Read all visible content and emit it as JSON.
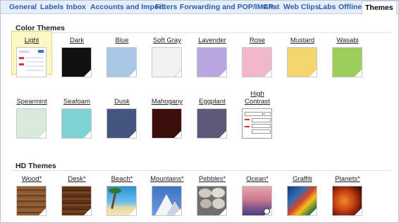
{
  "tabs": [
    {
      "label": "General",
      "active": false
    },
    {
      "label": "Labels",
      "active": false
    },
    {
      "label": "Inbox",
      "active": false
    },
    {
      "label": "Accounts and Import",
      "active": false
    },
    {
      "label": "Filters",
      "active": false
    },
    {
      "label": "Forwarding and POP/IMAP",
      "active": false
    },
    {
      "label": "Chat",
      "active": false
    },
    {
      "label": "Web Clips",
      "active": false
    },
    {
      "label": "Labs",
      "active": false
    },
    {
      "label": "Offline",
      "active": false
    },
    {
      "label": "Themes",
      "active": true
    }
  ],
  "color_themes": {
    "title": "Color Themes",
    "items": [
      {
        "label": "Light",
        "color": "#ffffff",
        "selected": true
      },
      {
        "label": "Dark",
        "color": "#111111"
      },
      {
        "label": "Blue",
        "color": "#a8c8e6"
      },
      {
        "label": "Soft Gray",
        "color": "#f0f0f0"
      },
      {
        "label": "Lavender",
        "color": "#b8a6df"
      },
      {
        "label": "Rose",
        "color": "#f0b8c8"
      },
      {
        "label": "Mustard",
        "color": "#f0d66c"
      },
      {
        "label": "Wasabi",
        "color": "#9ccc5a"
      },
      {
        "label": "Spearmint",
        "color": "#d7eadc"
      },
      {
        "label": "Seafoam",
        "color": "#7fd2d4"
      },
      {
        "label": "Dusk",
        "color": "#44557f"
      },
      {
        "label": "Mahogany",
        "color": "#3a0e0a"
      },
      {
        "label": "Eggplant",
        "color": "#5e5878"
      },
      {
        "label": "High Contrast",
        "color": "#ffffff"
      }
    ]
  },
  "hd_themes": {
    "title": "HD Themes",
    "items": [
      {
        "label": "Wood*",
        "color": "#7a4a22"
      },
      {
        "label": "Desk*",
        "color": "#6a3a1a"
      },
      {
        "label": "Beach*",
        "color": "#3fa0d8"
      },
      {
        "label": "Mountains*",
        "color": "#5a86c8"
      },
      {
        "label": "Pebbles*",
        "color": "#8a8a8a"
      },
      {
        "label": "Ocean*",
        "color": "#d07a8a"
      },
      {
        "label": "Graffiti",
        "color": "#2c4a7a"
      },
      {
        "label": "Planets*",
        "color": "#c0401a"
      }
    ]
  }
}
